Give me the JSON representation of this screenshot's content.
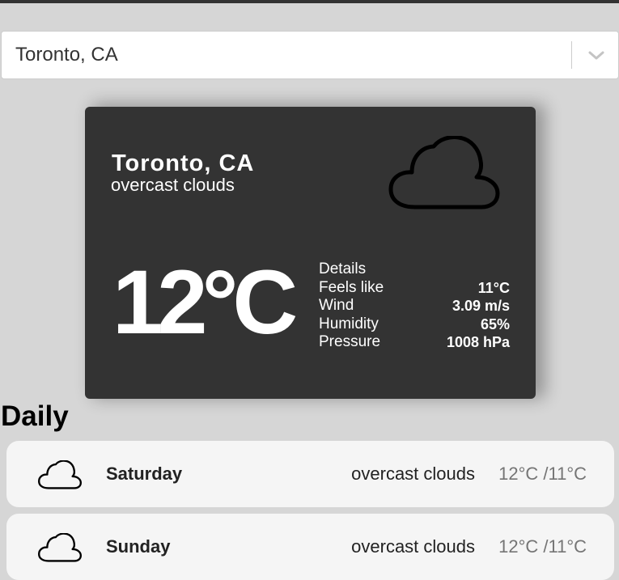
{
  "search": {
    "value": "Toronto, CA"
  },
  "current": {
    "city": "Toronto, CA",
    "description": "overcast clouds",
    "icon": "cloud-icon",
    "temperature": "12°C",
    "details_title": "Details",
    "details": [
      {
        "label": "Feels like",
        "value": "11°C"
      },
      {
        "label": "Wind",
        "value": "3.09 m/s"
      },
      {
        "label": "Humidity",
        "value": "65%"
      },
      {
        "label": "Pressure",
        "value": "1008 hPa"
      }
    ]
  },
  "daily": {
    "title": "Daily",
    "items": [
      {
        "icon": "cloud-icon",
        "day": "Saturday",
        "description": "overcast clouds",
        "temps": "12°C /11°C"
      },
      {
        "icon": "cloud-icon",
        "day": "Sunday",
        "description": "overcast clouds",
        "temps": "12°C /11°C"
      }
    ]
  },
  "colors": {
    "page_background": "#d6d6d6",
    "card_background": "#333333",
    "list_item_background": "#f5f5f5",
    "muted_text": "#757575"
  }
}
